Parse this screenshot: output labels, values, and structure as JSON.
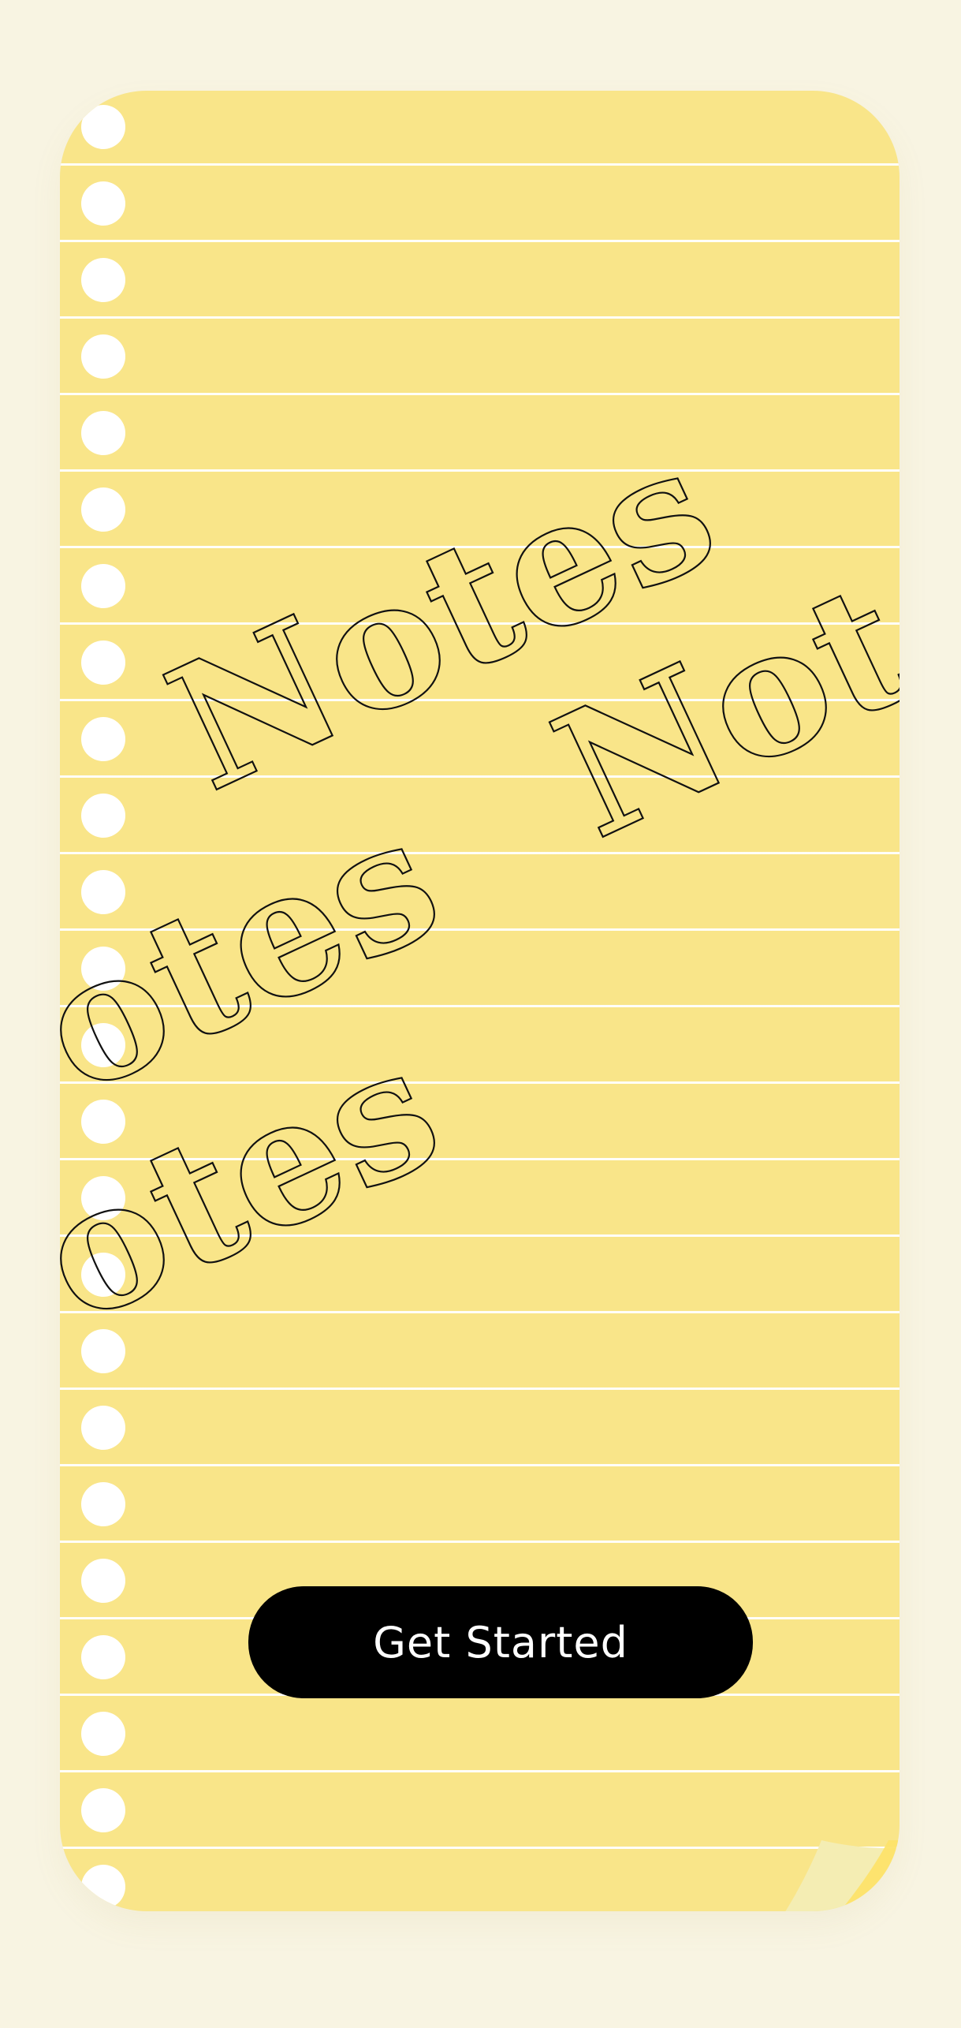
{
  "app": {
    "watermark_word": "Notes"
  },
  "actions": {
    "get_started_label": "Get Started"
  },
  "colors": {
    "page_background": "#f8f4e2",
    "paper": "#f9e589",
    "rule_lines": "#ffffff",
    "binder_holes": "#ffffff",
    "button_background": "#000000",
    "button_text": "#ffffff"
  },
  "icons": {
    "page_curl": "page-curl-icon"
  }
}
